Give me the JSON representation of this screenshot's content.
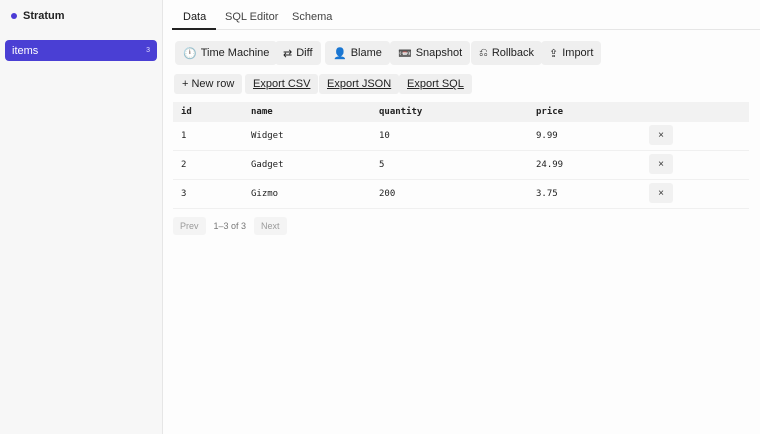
{
  "sidebar": {
    "brand": "Stratum",
    "items": [
      {
        "label": "items",
        "count": "3"
      }
    ]
  },
  "tabs": [
    "Data",
    "SQL Editor",
    "Schema"
  ],
  "toolbar": {
    "time_machine": {
      "icon": "🕛",
      "label": "Time Machine"
    },
    "diff": {
      "icon": "⇄",
      "label": "Diff"
    },
    "blame": {
      "icon": "👤",
      "label": "Blame"
    },
    "snapshot": {
      "icon": "📼",
      "label": "Snapshot"
    },
    "rollback": {
      "icon": "⎌",
      "label": "Rollback"
    },
    "import": {
      "icon": "⇪",
      "label": "Import"
    }
  },
  "actions": {
    "new_row": "+ New row",
    "export_csv": "Export CSV",
    "export_json": "Export JSON",
    "export_sql": "Export SQL"
  },
  "table": {
    "columns": [
      "id",
      "name",
      "quantity",
      "price"
    ],
    "rows": [
      [
        "1",
        "Widget",
        "10",
        "9.99"
      ],
      [
        "2",
        "Gadget",
        "5",
        "24.99"
      ],
      [
        "3",
        "Gizmo",
        "200",
        "3.75"
      ]
    ],
    "delete_label": "×"
  },
  "pager": {
    "prev": "Prev",
    "info": "1–3 of 3",
    "next": "Next"
  }
}
